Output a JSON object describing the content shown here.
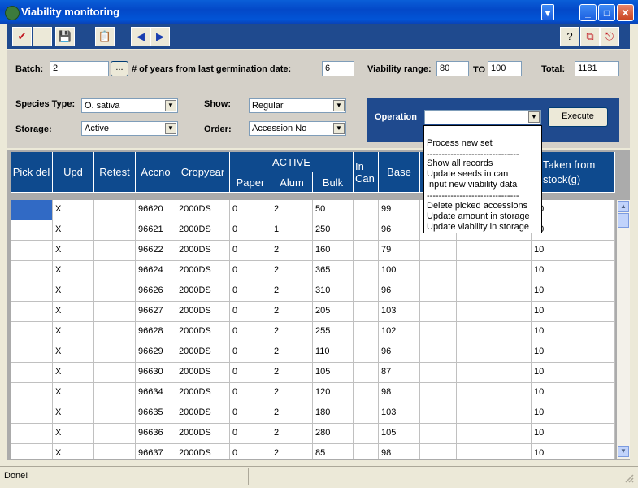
{
  "window": {
    "title": "Viability monitoring"
  },
  "toolbar": {
    "check": "✔",
    "save": "💾",
    "clipboard": "📋",
    "prev": "◀",
    "next": "▶",
    "help": "?",
    "copy": "⧉",
    "exit": "⎋"
  },
  "filters": {
    "batch_label": "Batch:",
    "batch_value": "2",
    "browse_label": "...",
    "years_label": "# of years from last germination date:",
    "years_value": "6",
    "range_label": "Viability range:",
    "range_from": "80",
    "range_to_label": "TO",
    "range_to": "100",
    "total_label": "Total:",
    "total_value": "1181",
    "species_label": "Species Type:",
    "species_value": "O. sativa",
    "show_label": "Show:",
    "show_value": "Regular",
    "storage_label": "Storage:",
    "storage_value": "Active",
    "order_label": "Order:",
    "order_value": "Accession No",
    "operation_label": "Operation",
    "operation_value": "",
    "execute_label": "Execute"
  },
  "operation_menu": [
    "Process new set",
    "-------------------------------",
    "Show all records",
    "Update seeds in can",
    "Input new viability data",
    "-------------------------------",
    "Delete picked accessions",
    "Update amount in storage",
    "Update viability in storage"
  ],
  "grid": {
    "headers": {
      "pick_del": "Pick del",
      "upd": "Upd",
      "retest": "Retest",
      "accno": "Accno",
      "cropyear": "Cropyear",
      "active": "ACTIVE",
      "paper": "Paper",
      "alum": "Alum",
      "bulk": "Bulk",
      "in_can": "In Can",
      "base": "Base",
      "taken": "Taken from stock(g)"
    },
    "rows": [
      {
        "pick": "",
        "upd": "X",
        "retest": "",
        "accno": "96620",
        "crop": "2000DS",
        "paper": "0",
        "alum": "2",
        "bulk": "50",
        "incan": "",
        "base": "99",
        "c11": "",
        "c12": "",
        "taken": "10"
      },
      {
        "pick": "",
        "upd": "X",
        "retest": "",
        "accno": "96621",
        "crop": "2000DS",
        "paper": "0",
        "alum": "1",
        "bulk": "250",
        "incan": "",
        "base": "96",
        "c11": "",
        "c12": "",
        "taken": "10"
      },
      {
        "pick": "",
        "upd": "X",
        "retest": "",
        "accno": "96622",
        "crop": "2000DS",
        "paper": "0",
        "alum": "2",
        "bulk": "160",
        "incan": "",
        "base": "79",
        "c11": "",
        "c12": "",
        "taken": "10"
      },
      {
        "pick": "",
        "upd": "X",
        "retest": "",
        "accno": "96624",
        "crop": "2000DS",
        "paper": "0",
        "alum": "2",
        "bulk": "365",
        "incan": "",
        "base": "100",
        "c11": "",
        "c12": "",
        "taken": "10"
      },
      {
        "pick": "",
        "upd": "X",
        "retest": "",
        "accno": "96626",
        "crop": "2000DS",
        "paper": "0",
        "alum": "2",
        "bulk": "310",
        "incan": "",
        "base": "96",
        "c11": "",
        "c12": "",
        "taken": "10"
      },
      {
        "pick": "",
        "upd": "X",
        "retest": "",
        "accno": "96627",
        "crop": "2000DS",
        "paper": "0",
        "alum": "2",
        "bulk": "205",
        "incan": "",
        "base": "103",
        "c11": "",
        "c12": "",
        "taken": "10"
      },
      {
        "pick": "",
        "upd": "X",
        "retest": "",
        "accno": "96628",
        "crop": "2000DS",
        "paper": "0",
        "alum": "2",
        "bulk": "255",
        "incan": "",
        "base": "102",
        "c11": "",
        "c12": "",
        "taken": "10"
      },
      {
        "pick": "",
        "upd": "X",
        "retest": "",
        "accno": "96629",
        "crop": "2000DS",
        "paper": "0",
        "alum": "2",
        "bulk": "110",
        "incan": "",
        "base": "96",
        "c11": "",
        "c12": "",
        "taken": "10"
      },
      {
        "pick": "",
        "upd": "X",
        "retest": "",
        "accno": "96630",
        "crop": "2000DS",
        "paper": "0",
        "alum": "2",
        "bulk": "105",
        "incan": "",
        "base": "87",
        "c11": "",
        "c12": "",
        "taken": "10"
      },
      {
        "pick": "",
        "upd": "X",
        "retest": "",
        "accno": "96634",
        "crop": "2000DS",
        "paper": "0",
        "alum": "2",
        "bulk": "120",
        "incan": "",
        "base": "98",
        "c11": "",
        "c12": "",
        "taken": "10"
      },
      {
        "pick": "",
        "upd": "X",
        "retest": "",
        "accno": "96635",
        "crop": "2000DS",
        "paper": "0",
        "alum": "2",
        "bulk": "180",
        "incan": "",
        "base": "103",
        "c11": "",
        "c12": "",
        "taken": "10"
      },
      {
        "pick": "",
        "upd": "X",
        "retest": "",
        "accno": "96636",
        "crop": "2000DS",
        "paper": "0",
        "alum": "2",
        "bulk": "280",
        "incan": "",
        "base": "105",
        "c11": "",
        "c12": "",
        "taken": "10"
      },
      {
        "pick": "",
        "upd": "X",
        "retest": "",
        "accno": "96637",
        "crop": "2000DS",
        "paper": "0",
        "alum": "2",
        "bulk": "85",
        "incan": "",
        "base": "98",
        "c11": "",
        "c12": "",
        "taken": "10"
      }
    ]
  },
  "status": {
    "text": "Done!"
  },
  "colors": {
    "header_bg": "#0e4a8e",
    "title_bg": "#0348c8",
    "selected_cell": "#316ac5"
  }
}
